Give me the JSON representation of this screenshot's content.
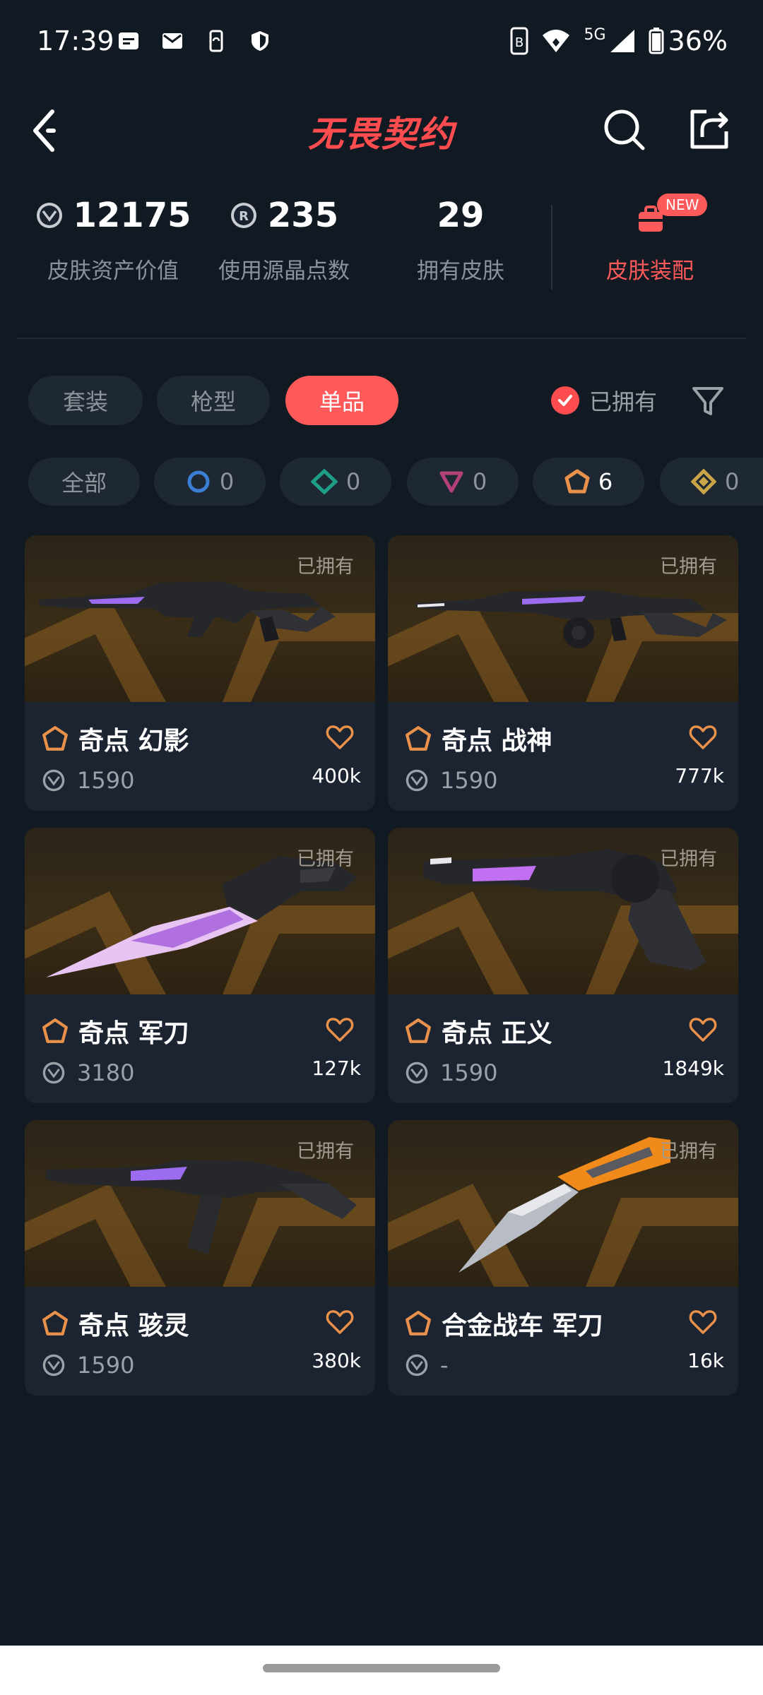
{
  "status_bar": {
    "time": "17:39",
    "network": "5G",
    "battery": "36%"
  },
  "header": {
    "title": "无畏契约"
  },
  "stats": [
    {
      "value": "12175",
      "label": "皮肤资产价值",
      "icon": "vp-coin-icon"
    },
    {
      "value": "235",
      "label": "使用源晶点数",
      "icon": "radianite-icon"
    },
    {
      "value": "29",
      "label": "拥有皮肤",
      "icon": ""
    }
  ],
  "outfit": {
    "label": "皮肤装配",
    "badge": "NEW"
  },
  "tabs": [
    {
      "label": "套装",
      "active": false
    },
    {
      "label": "枪型",
      "active": false
    },
    {
      "label": "单品",
      "active": true
    }
  ],
  "owned_filter": {
    "label": "已拥有",
    "checked": true
  },
  "rarity_filters": [
    {
      "label": "全部",
      "count": ""
    },
    {
      "tier": "select",
      "color": "#3b7fd4",
      "count": "0"
    },
    {
      "tier": "deluxe",
      "color": "#1e9e86",
      "count": "0"
    },
    {
      "tier": "premium",
      "color": "#b4407a",
      "count": "0"
    },
    {
      "tier": "exclusive",
      "color": "#e9914a",
      "count": "6"
    },
    {
      "tier": "ultra",
      "color": "#c9a548",
      "count": "0"
    }
  ],
  "items": [
    {
      "name": "奇点 幻影",
      "price": "1590",
      "likes": "400k",
      "owned": "已拥有",
      "weapon": "rifle"
    },
    {
      "name": "奇点 战神",
      "price": "1590",
      "likes": "777k",
      "owned": "已拥有",
      "weapon": "lmg"
    },
    {
      "name": "奇点 军刀",
      "price": "3180",
      "likes": "127k",
      "owned": "已拥有",
      "weapon": "knife"
    },
    {
      "name": "奇点 正义",
      "price": "1590",
      "likes": "1849k",
      "owned": "已拥有",
      "weapon": "revolver"
    },
    {
      "name": "奇点 骇灵",
      "price": "1590",
      "likes": "380k",
      "owned": "已拥有",
      "weapon": "smg"
    },
    {
      "name": "合金战车 军刀",
      "price": "-",
      "likes": "16k",
      "owned": "已拥有",
      "weapon": "orange-knife"
    }
  ]
}
